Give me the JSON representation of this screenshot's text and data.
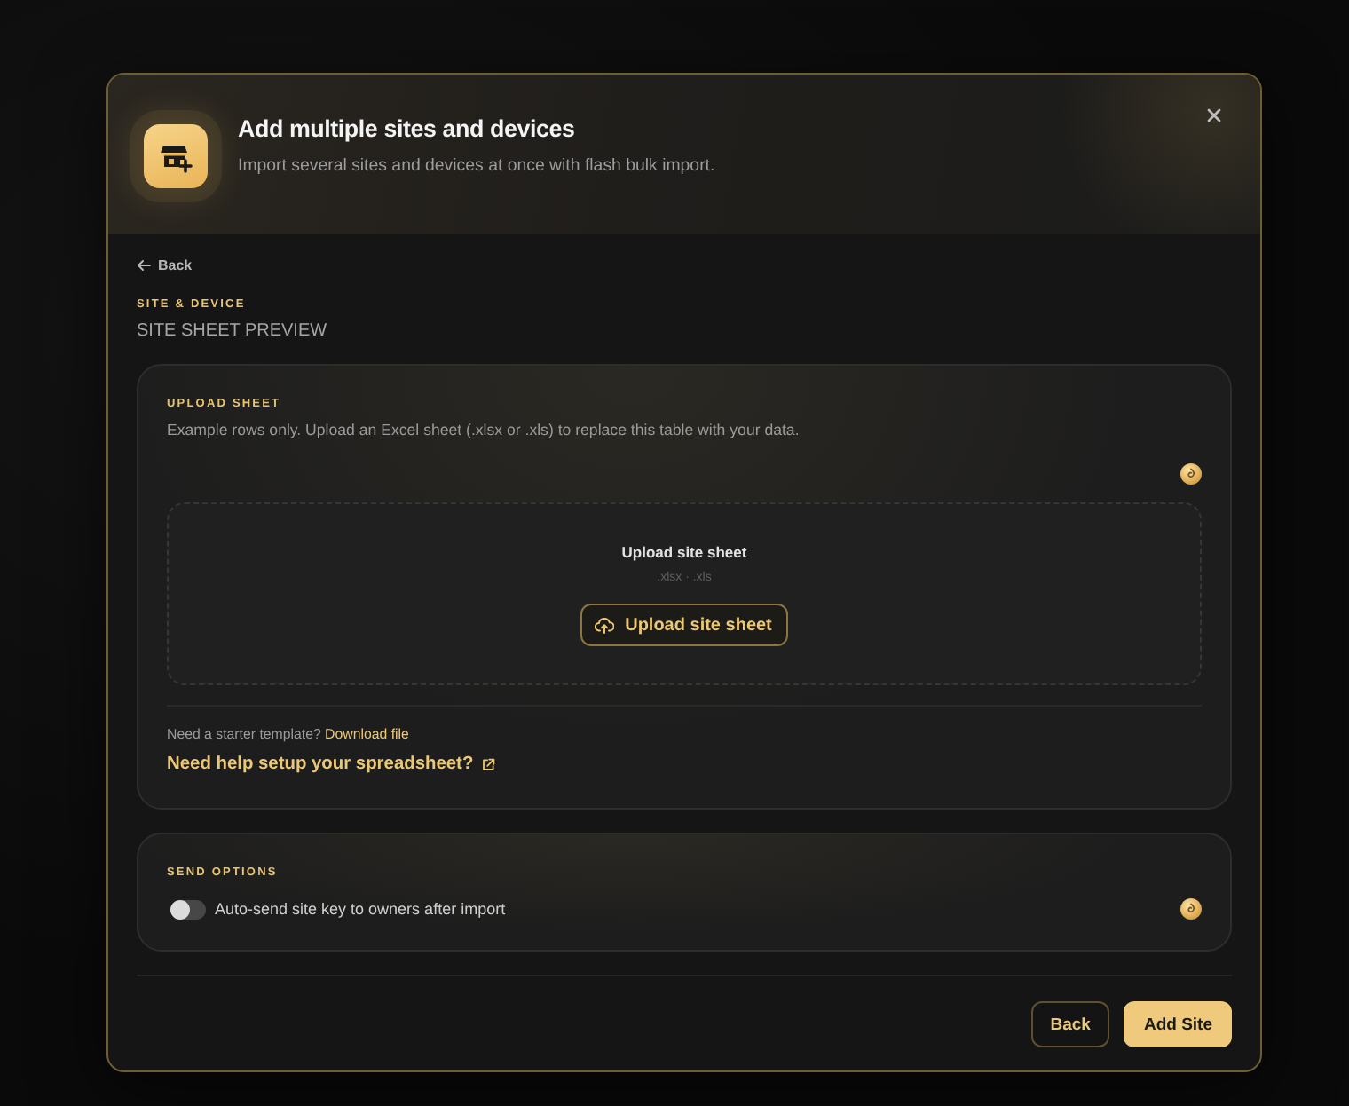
{
  "dialog": {
    "title": "Add multiple sites and devices",
    "subtitle": "Import several sites and devices at once with flash bulk import."
  },
  "back_link": "Back",
  "section": {
    "eyebrow": "SITE & DEVICE",
    "title": "SITE SHEET PREVIEW"
  },
  "upload_card": {
    "heading": "UPLOAD SHEET",
    "description": "Example rows only. Upload an Excel sheet (.xlsx or .xls) to replace this table with your data.",
    "dropzone": {
      "title": "Upload site sheet",
      "formats": ".xlsx · .xls",
      "button": "Upload site sheet"
    },
    "template_prompt": "Need a starter template?",
    "template_link": "Download file",
    "help_link": "Need help setup your spreadsheet?"
  },
  "send_options": {
    "heading": "SEND OPTIONS",
    "options": [
      {
        "label": "Auto-send site key to owners after import",
        "on": false
      }
    ]
  },
  "footer_buttons": [
    {
      "label": "Back",
      "kind": "secondary"
    },
    {
      "label": "Add Site",
      "kind": "primary"
    }
  ]
}
